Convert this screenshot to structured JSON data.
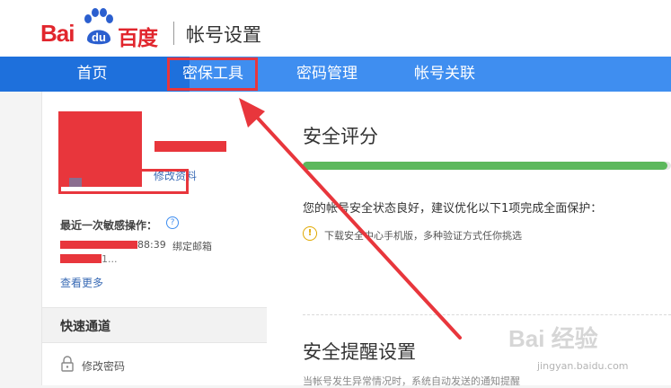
{
  "header": {
    "logo_text_bai": "Bai",
    "logo_text_du": "du",
    "logo_text_cn": "百度",
    "page_title": "帐号设置"
  },
  "nav": {
    "items": [
      {
        "label": "首页"
      },
      {
        "label": "密保工具"
      },
      {
        "label": "密码管理"
      },
      {
        "label": "帐号关联"
      }
    ],
    "active_color": "#1e70dc",
    "bar_color": "#3f8ef0"
  },
  "profile": {
    "edit_label": "修改资料"
  },
  "recent": {
    "title": "最近一次敏感操作：",
    "help_icon": "?",
    "time": "88:39",
    "action": "绑定邮箱",
    "extra": "1...",
    "view_more": "查看更多"
  },
  "quick": {
    "title": "快速通道",
    "change_password": "修改密码"
  },
  "security": {
    "score_title": "安全评分",
    "progress": 0.99,
    "status": "您的帐号安全状态良好，建议优化以下1项完成全面保护：",
    "tip_icon": "!",
    "tip": "下载安全中心手机版，多种验证方式任你挑选",
    "alert_title": "安全提醒设置",
    "alert_sub": "当帐号发生异常情况时，系统自动发送的通知提醒"
  },
  "watermark": {
    "main": "Bai 经验",
    "url": "jingyan.baidu.com"
  },
  "colors": {
    "annotation_red": "#e8363c",
    "progress_green": "#5cb85c",
    "brand_red": "#e1262d"
  }
}
